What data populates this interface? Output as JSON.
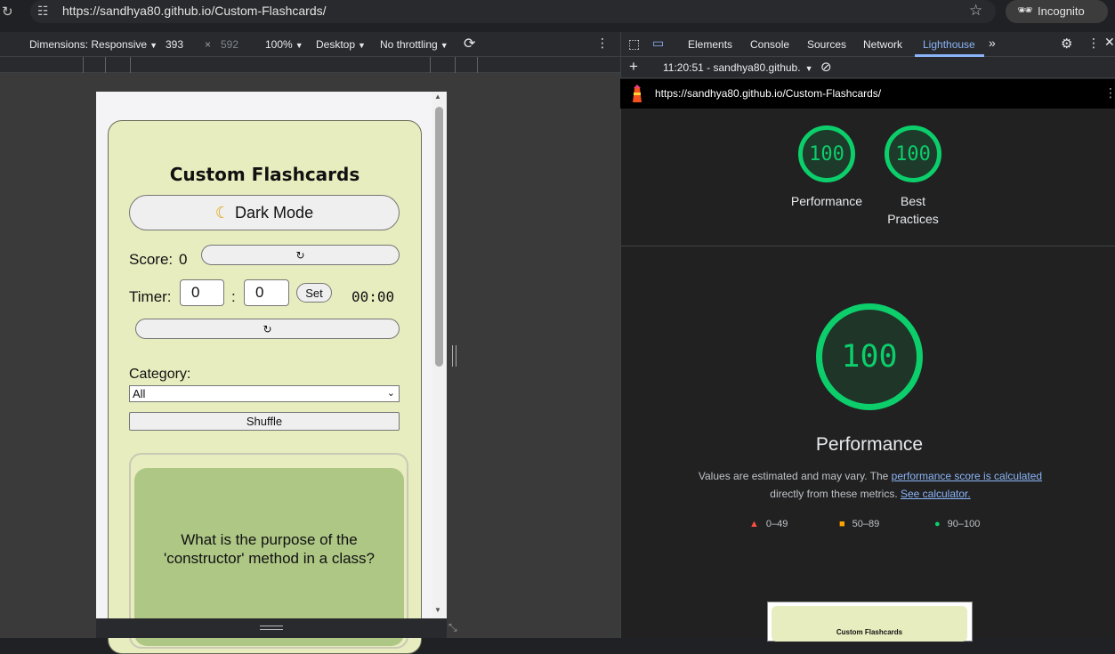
{
  "browser": {
    "url": "https://sandhya80.github.io/Custom-Flashcards/",
    "profile_label": "Incognito"
  },
  "device_toolbar": {
    "dimensions_label": "Dimensions: Responsive",
    "width": "393",
    "times": "×",
    "height": "592",
    "zoom": "100%",
    "device_type": "Desktop",
    "throttling": "No throttling"
  },
  "app": {
    "title": "Custom Flashcards",
    "dark_mode_label": "Dark Mode",
    "score_label": "Score:",
    "score_value": "0",
    "reset_glyph": "↻",
    "timer_label": "Timer:",
    "timer_minutes": "0",
    "timer_colon": ":",
    "timer_seconds": "0",
    "timer_set_label": "Set",
    "timer_display": "00:00",
    "category_label": "Category:",
    "category_selected": "All",
    "shuffle_label": "Shuffle",
    "card_question": "What is the purpose of the 'constructor' method in a class?"
  },
  "devtools": {
    "tabs": [
      "Elements",
      "Console",
      "Sources",
      "Network",
      "Lighthouse"
    ],
    "active_tab": "Lighthouse",
    "report_time": "11:20:51 - sandhya80.github.",
    "report_url": "https://sandhya80.github.io/Custom-Flashcards/"
  },
  "lighthouse": {
    "scores": [
      {
        "label": "Performance",
        "value": "100"
      },
      {
        "label": "Best Practices",
        "value": "100"
      }
    ],
    "main_score": "100",
    "main_title": "Performance",
    "desc_prefix": "Values are estimated and may vary. The ",
    "desc_link1": "performance score is calculated",
    "desc_middle": "directly from these metrics. ",
    "desc_link2": "See calculator.",
    "legend": [
      {
        "range": "0–49",
        "color": "#ff4e42"
      },
      {
        "range": "50–89",
        "color": "#ffa400"
      },
      {
        "range": "90–100",
        "color": "#0cce6b"
      }
    ],
    "thumbnail_title": "Custom Flashcards"
  }
}
